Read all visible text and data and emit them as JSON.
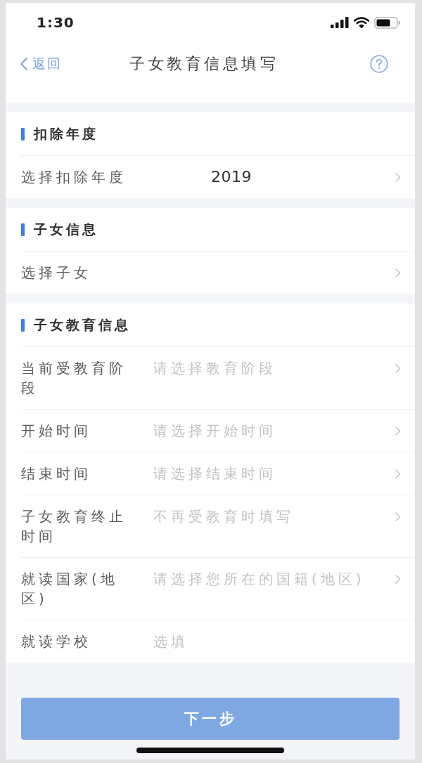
{
  "status_bar": {
    "time": "1:30"
  },
  "nav_bar": {
    "back_label": "返回",
    "title": "子女教育信息填写"
  },
  "sections": [
    {
      "title": "扣除年度",
      "rows": [
        {
          "kind": "select",
          "label": "选择扣除年度",
          "value": "2019"
        }
      ]
    },
    {
      "title": "子女信息",
      "rows": [
        {
          "kind": "select",
          "label": "选择子女"
        }
      ]
    },
    {
      "title": "子女教育信息",
      "rows": [
        {
          "kind": "select",
          "label": "当前受教育阶段",
          "placeholder": "请选择教育阶段"
        },
        {
          "kind": "select",
          "label": "开始时间",
          "placeholder": "请选择开始时间"
        },
        {
          "kind": "select",
          "label": "结束时间",
          "placeholder": "请选择结束时间"
        },
        {
          "kind": "select",
          "label": "子女教育终止时间",
          "placeholder": "不再受教育时填写"
        },
        {
          "kind": "select",
          "label": "就读国家(地区)",
          "placeholder": "请选择您所在的国籍(地区)"
        },
        {
          "kind": "input",
          "label": "就读学校",
          "placeholder": "选填"
        }
      ]
    }
  ],
  "next_button": {
    "label": "下一步",
    "disabled": true
  }
}
